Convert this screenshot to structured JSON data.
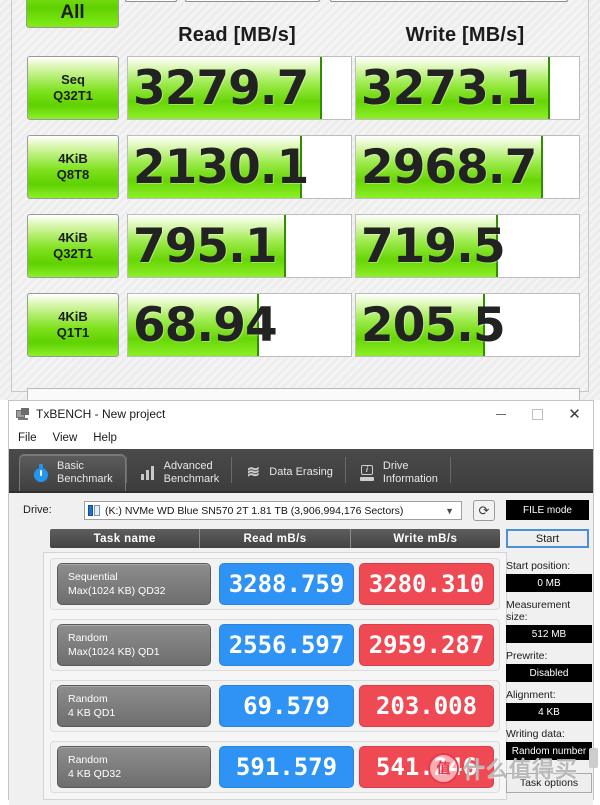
{
  "crystaldiskmark": {
    "all_button": "All",
    "header_read": "Read [MB/s]",
    "header_write": "Write [MB/s]",
    "rows": [
      {
        "label_line1": "Seq",
        "label_line2": "Q32T1",
        "read": "3279.7",
        "write": "3273.1",
        "read_fill_pct": 86,
        "write_fill_pct": 86
      },
      {
        "label_line1": "4KiB",
        "label_line2": "Q8T8",
        "read": "2130.1",
        "write": "2968.7",
        "read_fill_pct": 77,
        "write_fill_pct": 83
      },
      {
        "label_line1": "4KiB",
        "label_line2": "Q32T1",
        "read": "795.1",
        "write": "719.5",
        "read_fill_pct": 70,
        "write_fill_pct": 63
      },
      {
        "label_line1": "4KiB",
        "label_line2": "Q1T1",
        "read": "68.94",
        "write": "205.5",
        "read_fill_pct": 58,
        "write_fill_pct": 57
      }
    ]
  },
  "txbench": {
    "window_title": "TxBENCH - New project",
    "window_controls": {
      "minimize": "minimize-icon",
      "maximize": "maximize-icon",
      "close": "close-icon"
    },
    "menu": [
      "File",
      "View",
      "Help"
    ],
    "tabs": [
      {
        "line1": "Basic",
        "line2": "Benchmark",
        "icon": "stopwatch-icon",
        "active": true
      },
      {
        "line1": "Advanced",
        "line2": "Benchmark",
        "icon": "bar-chart-icon",
        "active": false
      },
      {
        "line1": "Data Erasing",
        "line2": "",
        "icon": "erase-icon",
        "active": false
      },
      {
        "line1": "Drive",
        "line2": "Information",
        "icon": "drive-info-icon",
        "active": false
      }
    ],
    "drive": {
      "label": "Drive:",
      "value": "(K:) NVMe WD Blue SN570 2T  1.81 TB (3,906,994,176 Sectors)",
      "refresh_icon": "refresh-icon",
      "mode_button": "FILE mode"
    },
    "table": {
      "headers": [
        "Task name",
        "Read mB/s",
        "Write mB/s"
      ],
      "rows": [
        {
          "name_line1": "Sequential",
          "name_line2": "Max(1024 KB) QD32",
          "read": "3288.759",
          "write": "3280.310"
        },
        {
          "name_line1": "Random",
          "name_line2": "Max(1024 KB) QD1",
          "read": "2556.597",
          "write": "2959.287"
        },
        {
          "name_line1": "Random",
          "name_line2": "4 KB QD1",
          "read": "69.579",
          "write": "203.008"
        },
        {
          "name_line1": "Random",
          "name_line2": "4 KB QD32",
          "read": "591.579",
          "write": "541.246"
        }
      ]
    },
    "sidebar": {
      "start_button": "Start",
      "fields": [
        {
          "label": "Start position:",
          "value": "0 MB"
        },
        {
          "label": "Measurement size:",
          "value": "512 MB"
        },
        {
          "label": "Prewrite:",
          "value": "Disabled"
        },
        {
          "label": "Alignment:",
          "value": "4 KB"
        },
        {
          "label": "Writing data:",
          "value": "Random number"
        }
      ],
      "task_options_button": "Task options"
    }
  },
  "watermark": {
    "logo_char": "值",
    "text": "什么值得买"
  },
  "colors": {
    "cdm_green": "#7ee11d",
    "tx_read_blue": "#2f93f5",
    "tx_write_red": "#ef4a54",
    "tab_bar_dark": "#434343"
  }
}
